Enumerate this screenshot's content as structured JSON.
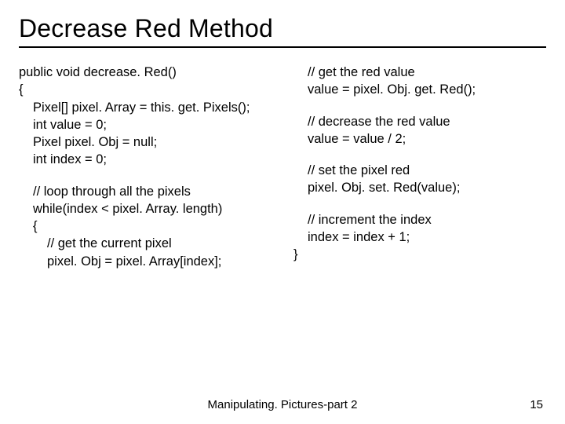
{
  "title": "Decrease Red Method",
  "left": {
    "l1": "public void decrease. Red()",
    "l2": "{",
    "l3": "Pixel[] pixel. Array = this. get. Pixels();",
    "l4": "int value = 0;",
    "l5": "Pixel pixel. Obj = null;",
    "l6": "int index = 0;",
    "l7": "// loop through all the pixels",
    "l8": "while(index < pixel. Array. length)",
    "l9": "{",
    "l10": "// get the current pixel",
    "l11": "pixel. Obj = pixel. Array[index];"
  },
  "right": {
    "r1": "// get the red value",
    "r2": "value = pixel. Obj. get. Red();",
    "r3": "// decrease the red value",
    "r4": "value = value / 2;",
    "r5": "// set the pixel red",
    "r6": "pixel. Obj. set. Red(value);",
    "r7": "// increment the index",
    "r8": "index = index + 1;",
    "r9": "}"
  },
  "footer": "Manipulating. Pictures-part 2",
  "page": "15"
}
